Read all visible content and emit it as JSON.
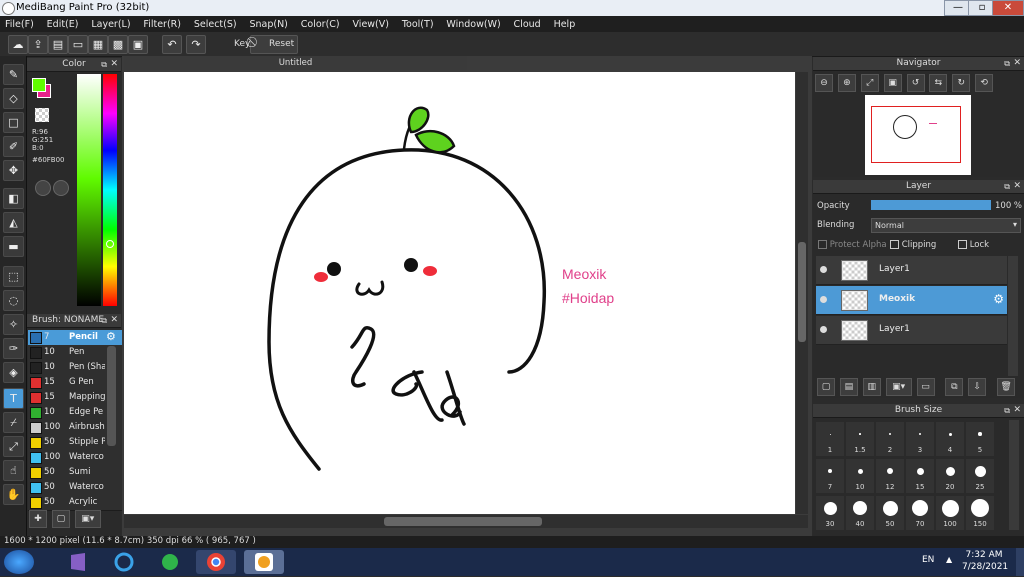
{
  "window": {
    "title": "MediBang Paint Pro (32bit)",
    "min": "—",
    "max": "▫",
    "close": "✕"
  },
  "menu": [
    "File(F)",
    "Edit(E)",
    "Layer(L)",
    "Filter(R)",
    "Select(S)",
    "Snap(N)",
    "Color(C)",
    "View(V)",
    "Tool(T)",
    "Window(W)",
    "Cloud",
    "Help"
  ],
  "toolbar": {
    "key_label": "Key",
    "reset_label": "Reset"
  },
  "color_panel": {
    "title": "Color",
    "r": "R:96",
    "g": "G:251",
    "b": "B:0",
    "hex": "#60FB00",
    "primary": "#60FB00",
    "secondary": "#E8208A"
  },
  "document": {
    "tab": "Untitled",
    "text_line1": "Meoxik",
    "text_line2": "#Hoidap",
    "text_color": "#E0408A"
  },
  "brush_panel": {
    "title": "Brush: NONAME",
    "brushes": [
      {
        "size": "7",
        "name": "Pencil",
        "color": "#2a6fb0",
        "selected": true
      },
      {
        "size": "10",
        "name": "Pen",
        "color": "#222222"
      },
      {
        "size": "10",
        "name": "Pen (Sha",
        "color": "#222222"
      },
      {
        "size": "15",
        "name": "G Pen",
        "color": "#e03030"
      },
      {
        "size": "15",
        "name": "Mapping",
        "color": "#e03030"
      },
      {
        "size": "10",
        "name": "Edge Pe",
        "color": "#30b030"
      },
      {
        "size": "100",
        "name": "Airbrush",
        "color": "#cccccc"
      },
      {
        "size": "50",
        "name": "Stipple P",
        "color": "#f0d000"
      },
      {
        "size": "100",
        "name": "Waterco",
        "color": "#40c0f0"
      },
      {
        "size": "50",
        "name": "Sumi",
        "color": "#f0d000"
      },
      {
        "size": "50",
        "name": "Waterco",
        "color": "#40c0f0"
      },
      {
        "size": "50",
        "name": "Acrylic",
        "color": "#f0d000"
      }
    ]
  },
  "navigator": {
    "title": "Navigator"
  },
  "layer_panel": {
    "title": "Layer",
    "opacity_label": "Opacity",
    "opacity_value": "100 %",
    "blending_label": "Blending",
    "blending_value": "Normal",
    "protect_alpha": "Protect Alpha",
    "clipping": "Clipping",
    "lock": "Lock",
    "layers": [
      {
        "name": "Layer1",
        "selected": false
      },
      {
        "name": "Meoxik",
        "selected": true
      },
      {
        "name": "Layer1",
        "selected": false
      }
    ]
  },
  "brush_size_panel": {
    "title": "Brush Size",
    "sizes": [
      "1",
      "1.5",
      "2",
      "3",
      "4",
      "5",
      "7",
      "10",
      "12",
      "15",
      "20",
      "25",
      "30",
      "40",
      "50",
      "70",
      "100",
      "150"
    ]
  },
  "status": {
    "text": "1600 * 1200 pixel  (11.6 * 8.7cm)  350 dpi  66 %  ( 965, 767 )"
  },
  "taskbar": {
    "lang": "EN",
    "time": "7:32 AM",
    "date": "7/28/2021"
  }
}
